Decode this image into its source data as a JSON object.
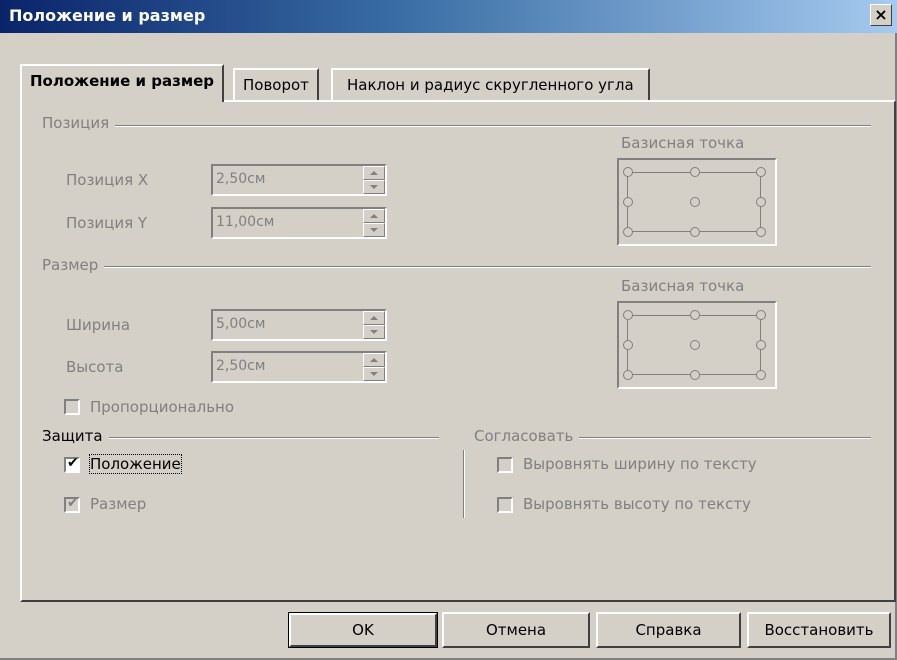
{
  "window": {
    "title": "Положение и размер",
    "close_glyph": "×"
  },
  "tabs": [
    {
      "label": "Положение и размер"
    },
    {
      "label": "Поворот"
    },
    {
      "label": "Наклон и радиус скругленного угла"
    }
  ],
  "position": {
    "section": "Позиция",
    "x_label": "Позиция X",
    "x_value": "2,50см",
    "y_label": "Позиция Y",
    "y_value": "11,00см",
    "base_point_label": "Базисная точка"
  },
  "size": {
    "section": "Размер",
    "width_label": "Ширина",
    "width_value": "5,00см",
    "height_label": "Высота",
    "height_value": "2,50см",
    "base_point_label": "Базисная точка",
    "proportional_label": "Пропорционально"
  },
  "protect": {
    "section": "Защита",
    "position_label": "Положение",
    "size_label": "Размер"
  },
  "adapt": {
    "section": "Согласовать",
    "fit_width_label": "Выровнять ширину по тексту",
    "fit_height_label": "Выровнять высоту по тексту"
  },
  "buttons": {
    "ok": "OK",
    "cancel": "Отмена",
    "help": "Справка",
    "reset": "Восстановить"
  },
  "check_glyph": "✔",
  "colors": {
    "dialog_bg": "#d4d0c8",
    "title_start": "#0a246a",
    "title_end": "#a6caf0"
  }
}
